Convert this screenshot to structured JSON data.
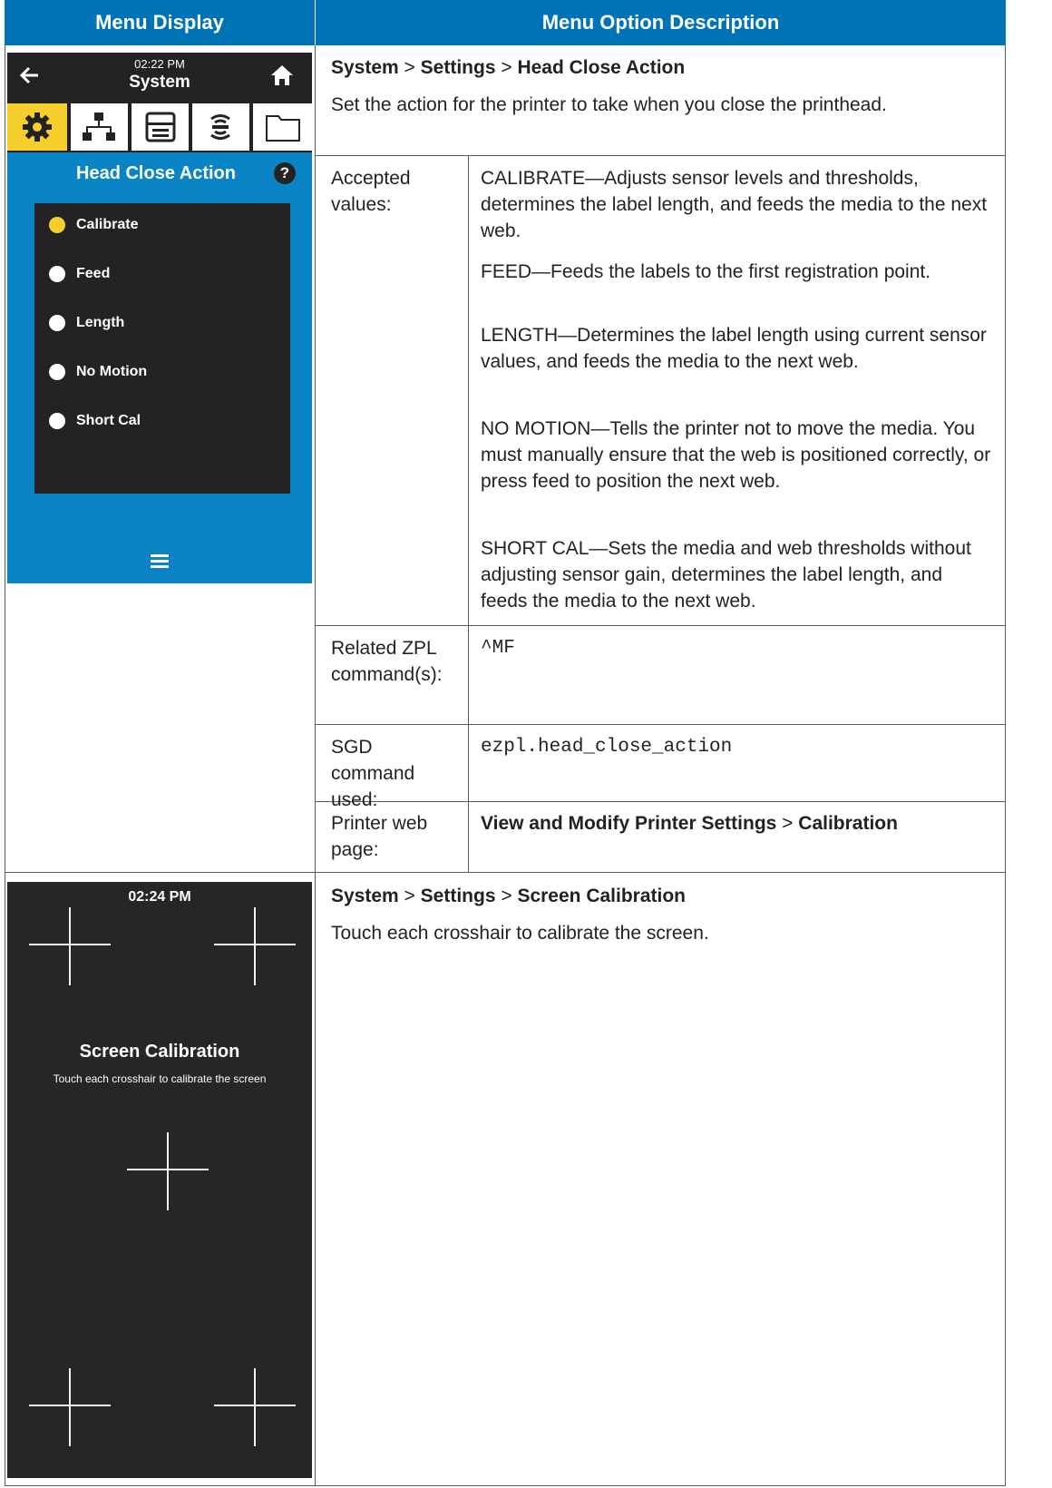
{
  "table": {
    "header_left": "Menu Display",
    "header_right": "Menu Option Description",
    "header_color": "#0073b7"
  },
  "section1": {
    "breadcrumb": {
      "p1": "System",
      "sep1": " > ",
      "p2": "Settings",
      "sep2": " > ",
      "p3": "Head Close Action"
    },
    "description": "Set the action for the printer to take when you close the printhead.",
    "accepted_label": "Accepted values:",
    "values": [
      "CALIBRATE—Adjusts sensor levels and thresholds, determines the label length, and feeds the media to the next web.",
      "FEED—Feeds the labels to the first registration point.",
      "LENGTH—Determines the label length using current sensor values, and feeds the media to the next web.",
      "NO MOTION—Tells the printer not to move the media. You must manually ensure that the web is positioned correctly, or press feed to position the next web.",
      "SHORT CAL—Sets the media and web thresholds without adjusting sensor gain, determines the label length, and feeds the media to the next web."
    ],
    "zpl_label": "Related ZPL command(s):",
    "zpl_value": "^MF",
    "sgd_label": "SGD command used:",
    "sgd_value": "ezpl.head_close_action",
    "web_label": "Printer web page:",
    "web_path": {
      "p1": "View and Modify Printer Settings",
      "sep": " > ",
      "p2": "Calibration"
    }
  },
  "device1": {
    "time": "02:22 PM",
    "title": "System",
    "menu_title": "Head Close Action",
    "help": "?",
    "options": [
      "Calibrate",
      "Feed",
      "Length",
      "No Motion",
      "Short Cal"
    ],
    "selected": "Calibrate",
    "back_icon": "arrow-left-icon",
    "home_icon": "home-icon",
    "tab_icons": [
      "gear-icon",
      "network-icon",
      "printer-icon",
      "wireless-icon",
      "folder-icon"
    ],
    "colors": {
      "screen": "#0b84c6",
      "bar": "#232323",
      "accent": "#f7cf2c"
    }
  },
  "section2": {
    "breadcrumb": {
      "p1": "System",
      "sep1": " > ",
      "p2": "Settings",
      "sep2": " > ",
      "p3": "Screen Calibration"
    },
    "description": "Touch each crosshair to calibrate the screen."
  },
  "device2": {
    "time": "02:24 PM",
    "title": "Screen Calibration",
    "subtitle": "Touch each crosshair to calibrate the screen"
  }
}
